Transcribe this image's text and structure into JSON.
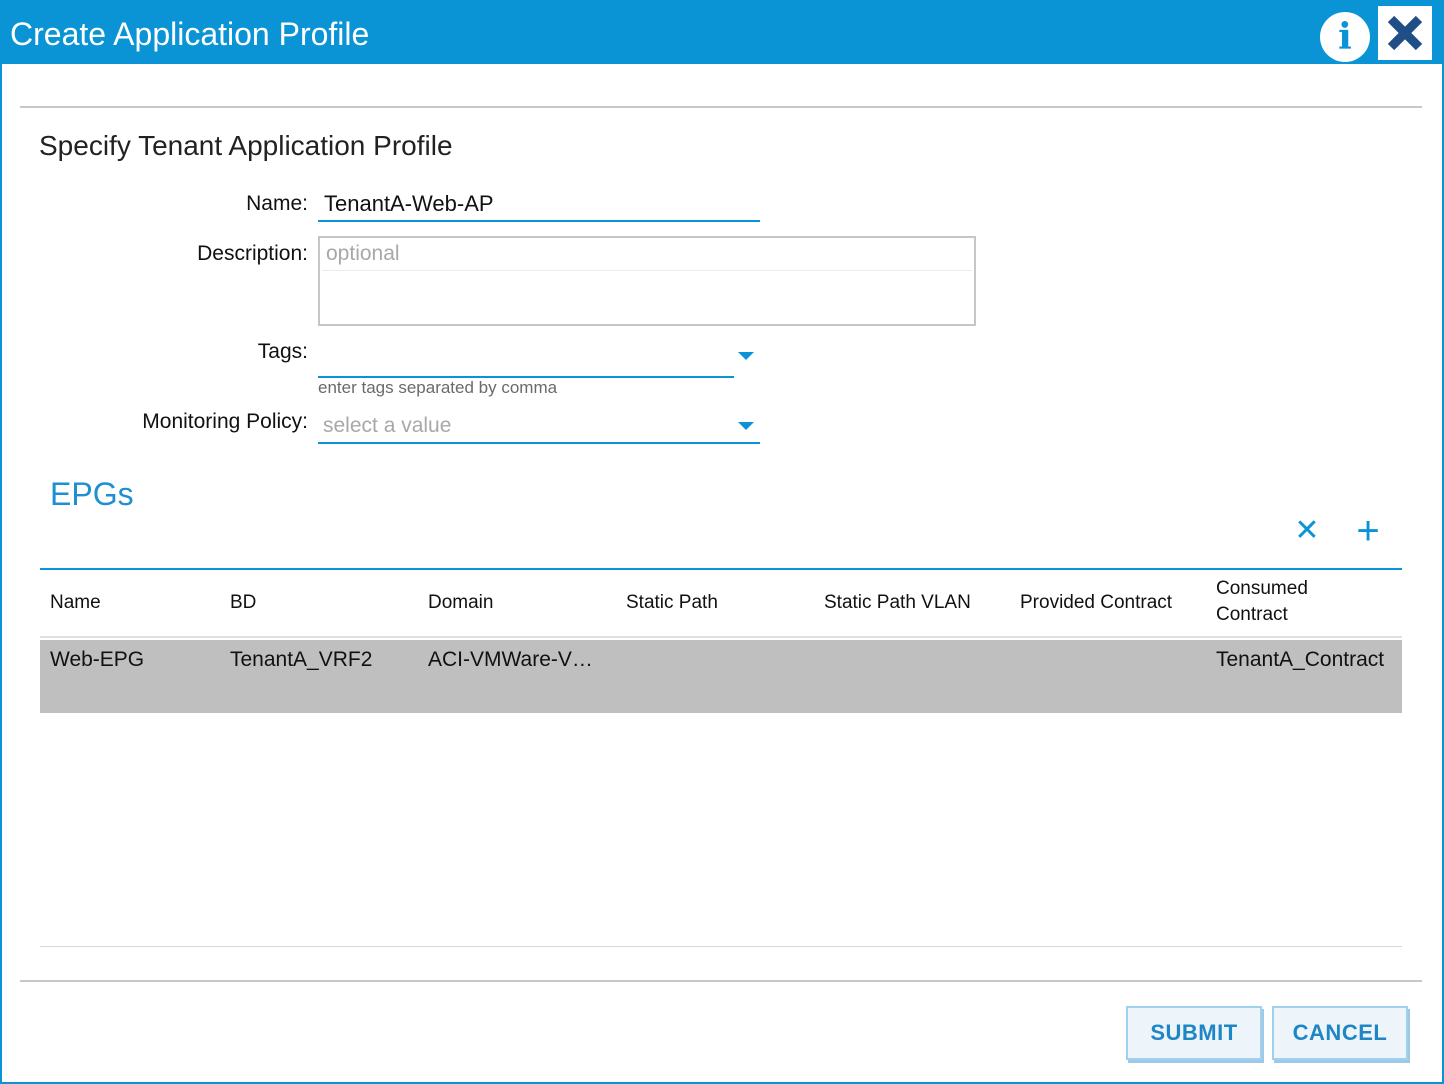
{
  "dialog": {
    "title": "Create Application Profile",
    "info_icon": "info-icon",
    "close_icon": "close-icon"
  },
  "section_title": "Specify Tenant Application Profile",
  "form": {
    "name_label": "Name:",
    "name_value": "TenantA-Web-AP",
    "description_label": "Description:",
    "description_placeholder": "optional",
    "tags_label": "Tags:",
    "tags_hint": "enter tags separated by comma",
    "monitoring_label": "Monitoring Policy:",
    "monitoring_placeholder": "select a value"
  },
  "epgs": {
    "title": "EPGs",
    "delete_glyph": "✕",
    "add_glyph": "+",
    "columns": [
      "Name",
      "BD",
      "Domain",
      "Static Path",
      "Static Path VLAN",
      "Provided Contract",
      "Consumed Contract"
    ],
    "rows": [
      {
        "name": "Web-EPG",
        "bd": "TenantA_VRF2",
        "domain": "ACI-VMWare-V…",
        "static_path": "",
        "static_path_vlan": "",
        "provided_contract": "",
        "consumed_contract": "TenantA_Contract"
      }
    ]
  },
  "buttons": {
    "submit": "SUBMIT",
    "cancel": "CANCEL"
  },
  "colors": {
    "accent": "#0a94d6",
    "row_selected": "#bfbfbf"
  }
}
